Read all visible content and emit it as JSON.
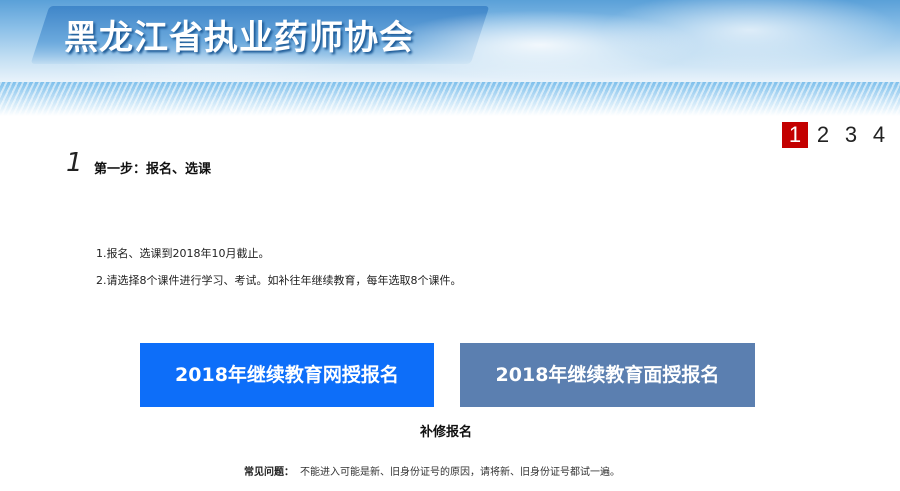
{
  "header": {
    "title": "黑龙江省执业药师协会"
  },
  "steps": {
    "items": [
      "1",
      "2",
      "3",
      "4"
    ],
    "active": "1"
  },
  "step": {
    "number": "1",
    "title": "第一步：报名、选课"
  },
  "notes": [
    "1.报名、选课到2018年10月截止。",
    "2.请选择8个课件进行学习、考试。如补往年继续教育，每年选取8个课件。"
  ],
  "buttons": {
    "online": "2018年继续教育网授报名",
    "face": "2018年继续教育面授报名",
    "makeup": "补修报名"
  },
  "faq": {
    "label": "常见问题：",
    "text": "不能进入可能是新、旧身份证号的原因，请将新、旧身份证号都试一遍。"
  },
  "colors": {
    "active_step": "#c30000",
    "online_button": "#0d6ef9",
    "face_button": "#5b7fb0"
  }
}
